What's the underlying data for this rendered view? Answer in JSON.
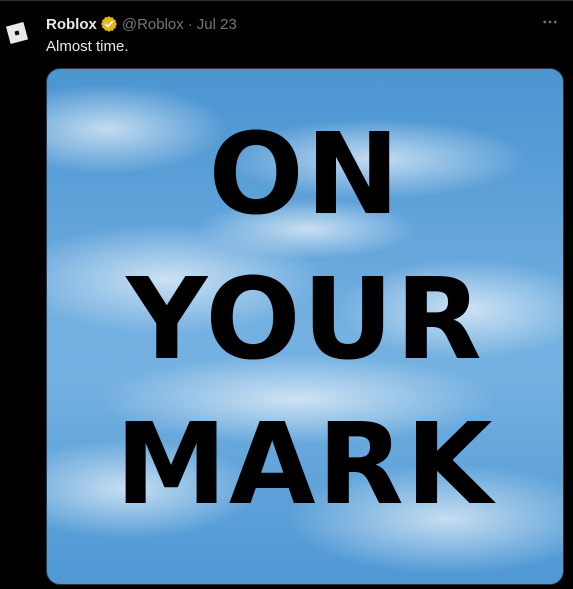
{
  "tweet": {
    "author_name": "Roblox",
    "handle": "@Roblox",
    "separator": "·",
    "date": "Jul 23",
    "text": "Almost time."
  },
  "media": {
    "lines": [
      "ON",
      "YOUR",
      "MARK"
    ]
  },
  "icons": {
    "avatar": "roblox-logo-icon",
    "verified": "verified-badge-icon",
    "more": "more-options-icon"
  },
  "colors": {
    "background": "#000000",
    "primary_text": "#e7e9ea",
    "secondary_text": "#71767b",
    "verified_gold": "#e2b719",
    "image_text": "#000000",
    "sky_blue": "#6aa9de"
  }
}
